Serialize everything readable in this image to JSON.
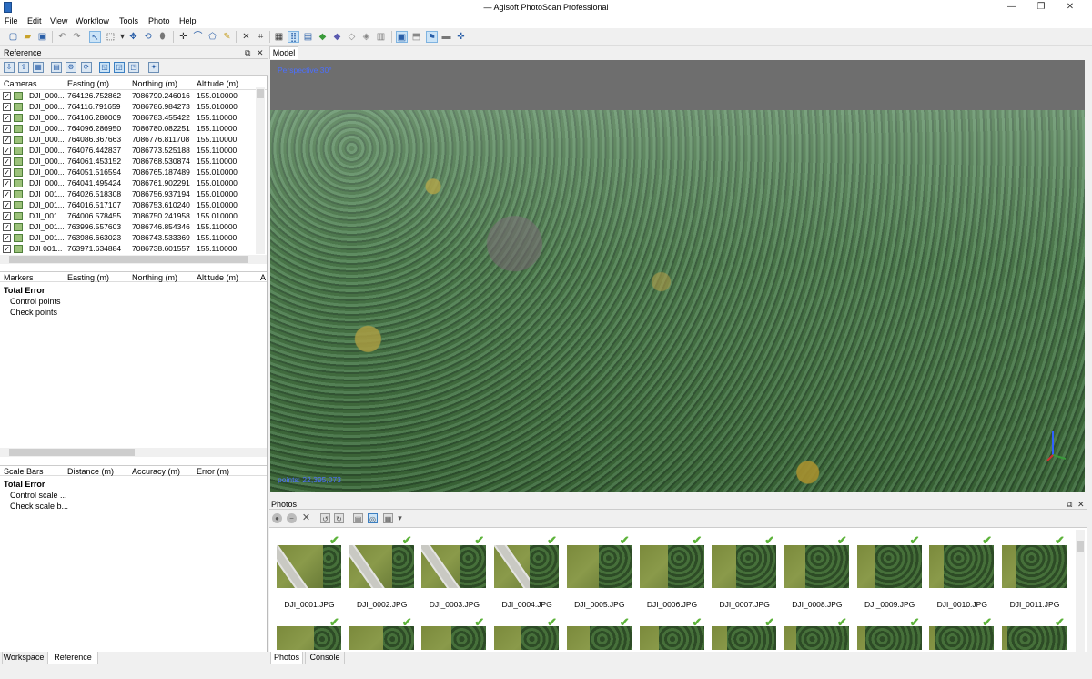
{
  "window": {
    "title": "— Agisoft PhotoScan Professional",
    "minimize": "—",
    "restore": "❐",
    "close": "✕"
  },
  "menu": [
    "File",
    "Edit",
    "View",
    "Workflow",
    "Tools",
    "Photo",
    "Help"
  ],
  "reference_panel": {
    "title": "Reference",
    "cameras": {
      "headers": [
        "Cameras",
        "Easting (m)",
        "Northing (m)",
        "Altitude (m)"
      ],
      "rows": [
        {
          "name": "DJI_000...",
          "easting": "764126.752862",
          "northing": "7086790.246016",
          "altitude": "155.010000"
        },
        {
          "name": "DJI_000...",
          "easting": "764116.791659",
          "northing": "7086786.984273",
          "altitude": "155.010000"
        },
        {
          "name": "DJI_000...",
          "easting": "764106.280009",
          "northing": "7086783.455422",
          "altitude": "155.110000"
        },
        {
          "name": "DJI_000...",
          "easting": "764096.286950",
          "northing": "7086780.082251",
          "altitude": "155.110000"
        },
        {
          "name": "DJI_000...",
          "easting": "764086.367663",
          "northing": "7086776.811708",
          "altitude": "155.110000"
        },
        {
          "name": "DJI_000...",
          "easting": "764076.442837",
          "northing": "7086773.525188",
          "altitude": "155.110000"
        },
        {
          "name": "DJI_000...",
          "easting": "764061.453152",
          "northing": "7086768.530874",
          "altitude": "155.110000"
        },
        {
          "name": "DJI_000...",
          "easting": "764051.516594",
          "northing": "7086765.187489",
          "altitude": "155.010000"
        },
        {
          "name": "DJI_000...",
          "easting": "764041.495424",
          "northing": "7086761.902291",
          "altitude": "155.010000"
        },
        {
          "name": "DJI_001...",
          "easting": "764026.518308",
          "northing": "7086756.937194",
          "altitude": "155.010000"
        },
        {
          "name": "DJI_001...",
          "easting": "764016.517107",
          "northing": "7086753.610240",
          "altitude": "155.010000"
        },
        {
          "name": "DJI_001...",
          "easting": "764006.578455",
          "northing": "7086750.241958",
          "altitude": "155.010000"
        },
        {
          "name": "DJI_001...",
          "easting": "763996.557603",
          "northing": "7086746.854346",
          "altitude": "155.110000"
        },
        {
          "name": "DJI_001...",
          "easting": "763986.663023",
          "northing": "7086743.533369",
          "altitude": "155.110000"
        },
        {
          "name": "DJI 001...",
          "easting": "763971.634884",
          "northing": "7086738.601557",
          "altitude": "155.110000"
        }
      ]
    },
    "markers": {
      "headers": [
        "Markers",
        "Easting (m)",
        "Northing (m)",
        "Altitude (m)",
        "A"
      ],
      "items": [
        "Total Error",
        "Control points",
        "Check points"
      ]
    },
    "scalebars": {
      "headers": [
        "Scale Bars",
        "Distance (m)",
        "Accuracy (m)",
        "Error (m)"
      ],
      "items": [
        "Total Error",
        "Control scale ...",
        "Check scale b..."
      ]
    }
  },
  "model": {
    "tab": "Model",
    "perspective": "Perspective 30°",
    "points": "points: 22,395,073"
  },
  "photos_panel": {
    "title": "Photos",
    "row1": [
      "DJI_0001.JPG",
      "DJI_0002.JPG",
      "DJI_0003.JPG",
      "DJI_0004.JPG",
      "DJI_0005.JPG",
      "DJI_0006.JPG",
      "DJI_0007.JPG",
      "DJI_0008.JPG",
      "DJI_0009.JPG",
      "DJI_0010.JPG",
      "DJI_0011.JPG"
    ]
  },
  "bottom_tabs": {
    "left": [
      "Workspace",
      "Reference"
    ],
    "right": [
      "Photos",
      "Console"
    ]
  },
  "colors": {
    "accent": "#4b6fff",
    "check": "#5db33a"
  }
}
